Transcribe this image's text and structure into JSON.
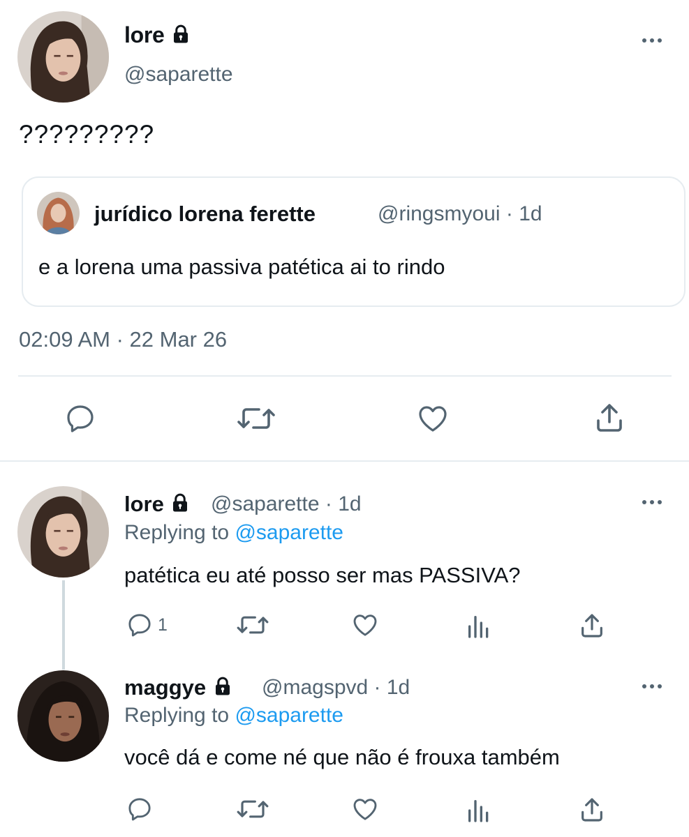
{
  "main_tweet": {
    "name": "lore",
    "handle": "@saparette",
    "text": "?????????",
    "timestamp": "02:09 AM · 22 Mar 26",
    "quoted": {
      "name": "jurídico lorena ferette",
      "handle": "@ringsmyoui",
      "age": "1d",
      "separator": "·",
      "text": "e a lorena uma passiva patética ai to rindo"
    },
    "actions": [
      "reply-icon",
      "retweet-icon",
      "like-icon",
      "share-icon"
    ]
  },
  "replies": [
    {
      "name": "lore",
      "handle": "@saparette",
      "age": "1d",
      "separator": "·",
      "replying_prefix": "Replying to",
      "replying_to": "@saparette",
      "text": "patética eu até posso ser mas PASSIVA?",
      "reply_count": "1"
    },
    {
      "name": "maggye",
      "handle": "@magspvd",
      "age": "1d",
      "separator": "·",
      "replying_prefix": "Replying to",
      "replying_to": "@saparette",
      "text": "você dá e come né que não é frouxa também",
      "reply_count": ""
    }
  ],
  "colors": {
    "text": "#0f1419",
    "secondary": "#536471",
    "link": "#1d9bf0",
    "border": "#e6ecf0"
  }
}
